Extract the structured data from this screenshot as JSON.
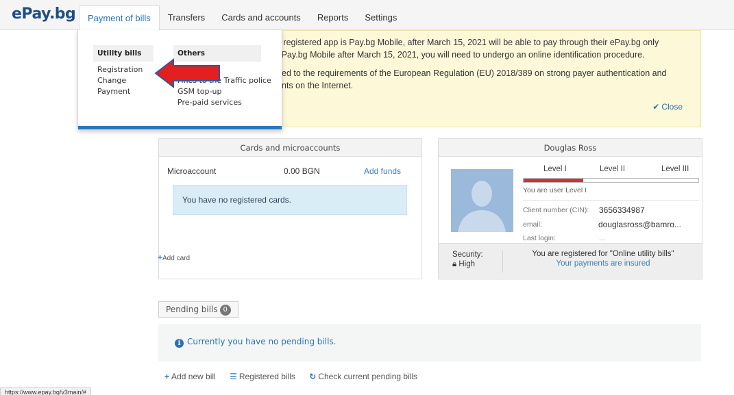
{
  "brand": {
    "logo": "ePay.bg"
  },
  "nav": {
    "items": [
      "Payment of bills",
      "Transfers",
      "Cards and accounts",
      "Reports",
      "Settings"
    ]
  },
  "notice": {
    "lines": [
      "a registered app is Pay.bg Mobile, after March 15, 2021 will be able to pay through their ePay.bg only",
      "r Pay.bg Mobile after March 15, 2021, you will need to undergo an online identification procedure.",
      "ed to the requirements of the European Regulation (EU) 2018/389 on strong payer authentication and",
      "nts on the Internet."
    ],
    "close_label": "Close"
  },
  "dropdown": {
    "utility": {
      "title": "Utility bills",
      "items": [
        "Registration",
        "Change",
        "Payment"
      ]
    },
    "others": {
      "title": "Others",
      "items": [
        "Fines to the Traffic police",
        "GSM top-up",
        "Pre-paid services"
      ]
    }
  },
  "cards_panel": {
    "title": "Cards and microaccounts",
    "microaccount_label": "Microaccount",
    "amount": "0.00 BGN",
    "add_funds": "Add funds",
    "no_cards": "You have no registered cards.",
    "add_card": "Add card"
  },
  "profile": {
    "name": "Douglas Ross",
    "levels": [
      "Level I",
      "Level II",
      "Level III"
    ],
    "level_progress": 0.34,
    "level_text": "You are user Level I",
    "client_number_label": "Client number (CIN):",
    "client_number": "3656334987",
    "email_label": "email:",
    "email": "douglasross@bamro...",
    "last_login_label": "Last login:",
    "last_login": "...",
    "security_label": "Security:",
    "security_value": "High",
    "registered_text": "You are registered for \"Online utility bills\"",
    "insured_text": "Your payments are insured"
  },
  "pending": {
    "tab_label": "Pending bills",
    "count": "0",
    "message": "Currently you have no pending bills."
  },
  "actions": [
    "Add new bill",
    "Registered bills",
    "Check current pending bills"
  ],
  "status_url": "https://www.epay.bg/v3main/#"
}
